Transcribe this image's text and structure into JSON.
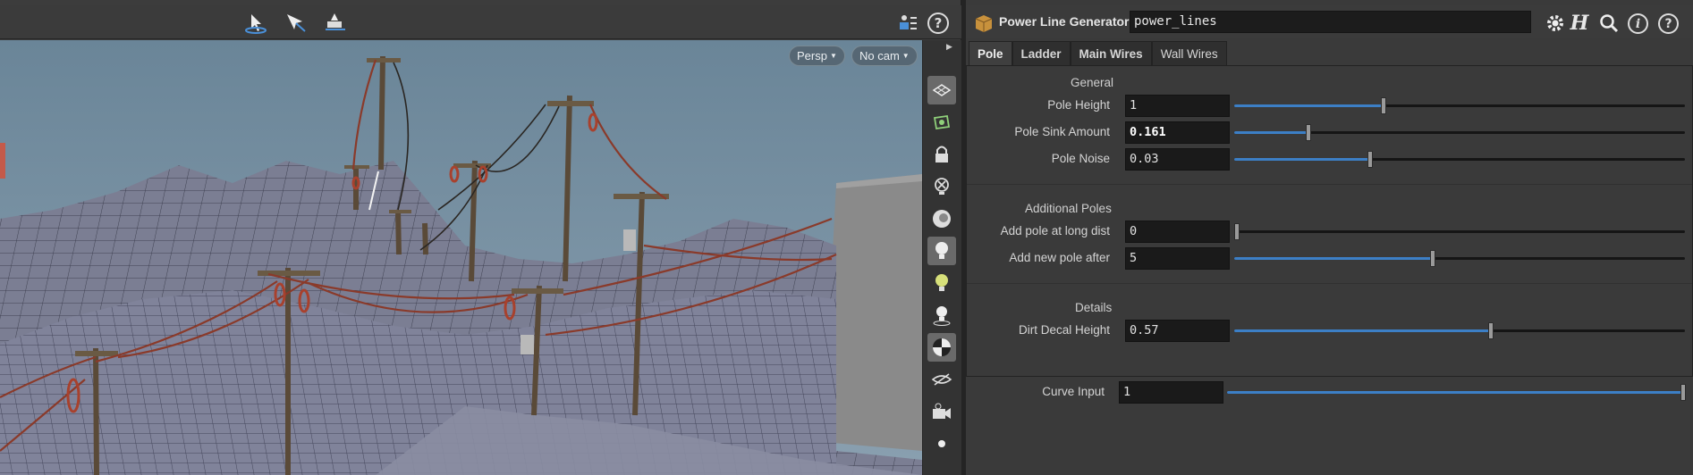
{
  "viewport": {
    "camera_view": "Persp",
    "camera_select": "No cam",
    "toolbar_icons": [
      "tumble-select-icon",
      "select-arrow-icon",
      "transform-handle-icon",
      "display-options-icon",
      "help-icon"
    ],
    "help_glyph": "?",
    "side_icons": [
      "grid-icon",
      "snap-icon",
      "lock-icon",
      "ghost-icon",
      "shading-icon",
      "light-icon",
      "headlight-icon",
      "light-bulb-icon",
      "render-ball-icon",
      "camera-toggle-icon",
      "camera-icon",
      "dot-icon"
    ]
  },
  "node": {
    "type_label": "Power Line Generator",
    "name": "power_lines",
    "header_icons": [
      "gear-icon",
      "houdini-h-icon",
      "search-icon",
      "info-icon",
      "help-icon"
    ],
    "help_glyph": "?",
    "info_glyph": "i"
  },
  "tabs": [
    "Pole",
    "Ladder",
    "Main Wires",
    "Wall Wires"
  ],
  "active_tab": "Pole",
  "sections": {
    "general": "General",
    "additional": "Additional Poles",
    "details": "Details"
  },
  "params": {
    "pole_height": {
      "label": "Pole Height",
      "value": "1",
      "fraction": 0.33
    },
    "pole_sink": {
      "label": "Pole Sink Amount",
      "value": "0.161",
      "fraction": 0.161
    },
    "pole_noise": {
      "label": "Pole Noise",
      "value": "0.03",
      "fraction": 0.3
    },
    "add_long": {
      "label": "Add pole at long dist",
      "value": "0",
      "fraction": 0.0
    },
    "add_after": {
      "label": "Add new pole after",
      "value": "5",
      "fraction": 0.44
    },
    "dirt_decal": {
      "label": "Dirt Decal Height",
      "value": "0.57",
      "fraction": 0.57
    },
    "curve_input": {
      "label": "Curve Input",
      "value": "1",
      "fraction": 1.0
    }
  },
  "colors": {
    "slider_fill": "#3c7fc6",
    "sky": "#6f8aa0",
    "terrain": "#7c7f94",
    "wire": "#8a3a2a",
    "pole": "#5a4a38"
  }
}
